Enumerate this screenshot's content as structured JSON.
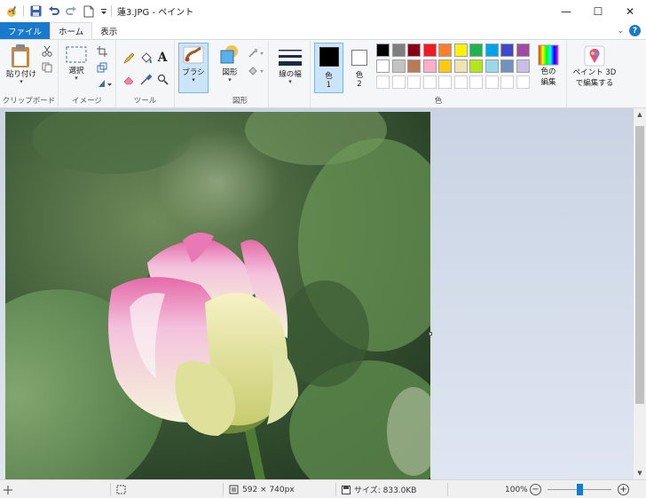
{
  "window": {
    "title": "蓮3.JPG - ペイント",
    "controls": {
      "minimize": "—",
      "maximize": "☐",
      "close": "✕"
    }
  },
  "tabs": [
    {
      "label": "ファイル"
    },
    {
      "label": "ホーム"
    },
    {
      "label": "表示"
    }
  ],
  "ribbon": {
    "clipboard": {
      "paste_label": "貼り付け",
      "group_label": "クリップボード"
    },
    "image": {
      "select_label": "選択",
      "group_label": "イメージ"
    },
    "tools": {
      "group_label": "ツール"
    },
    "brushes": {
      "label": "ブラシ"
    },
    "shapes": {
      "label": "図形",
      "group_label": "図形"
    },
    "size": {
      "label": "線の幅"
    },
    "color1": {
      "label_line1": "色",
      "label_line2": "1",
      "value": "#000000"
    },
    "color2": {
      "label_line1": "色",
      "label_line2": "2",
      "value": "#ffffff"
    },
    "edit_colors": {
      "label_line1": "色の",
      "label_line2": "編集"
    },
    "colors_group_label": "色",
    "paint3d": {
      "label_line1": "ペイント 3D",
      "label_line2": "で編集する"
    },
    "palette_row1": [
      "#000000",
      "#7f7f7f",
      "#880015",
      "#ed1c24",
      "#ff7f27",
      "#fff200",
      "#22b14c",
      "#00a2e8",
      "#3f48cc",
      "#a349a4"
    ],
    "palette_row2": [
      "#ffffff",
      "#c3c3c3",
      "#b97a57",
      "#ffaec9",
      "#ffc90e",
      "#efe4b0",
      "#b5e61d",
      "#99d9ea",
      "#7092be",
      "#c8bfe7"
    ]
  },
  "status": {
    "selection_size": "592 × 740px",
    "file_size": "サイズ: 833.0KB",
    "zoom": "100%",
    "zoom_level": 0.5
  }
}
